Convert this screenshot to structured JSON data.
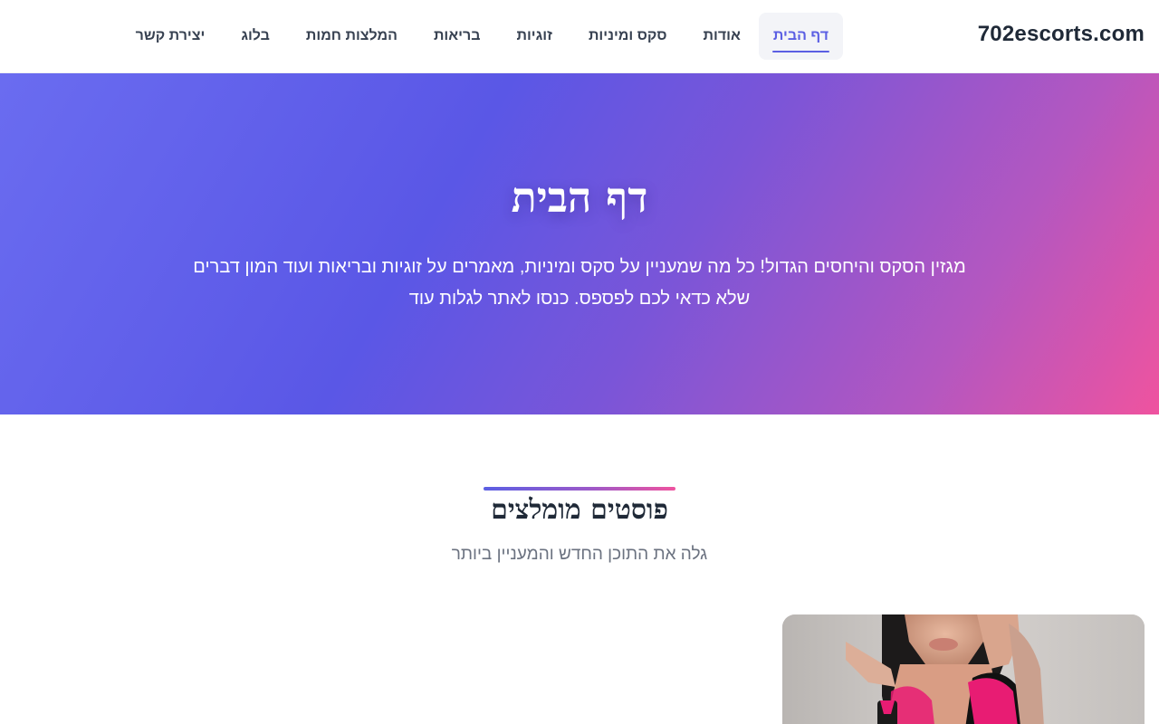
{
  "header": {
    "logo": "702escorts.com",
    "nav": [
      {
        "label": "דף הבית",
        "active": true
      },
      {
        "label": "אודות",
        "active": false
      },
      {
        "label": "סקס ומיניות",
        "active": false
      },
      {
        "label": "זוגיות",
        "active": false
      },
      {
        "label": "בריאות",
        "active": false
      },
      {
        "label": "המלצות חמות",
        "active": false
      },
      {
        "label": "בלוג",
        "active": false
      },
      {
        "label": "יצירת קשר",
        "active": false
      }
    ]
  },
  "hero": {
    "title": "דף הבית",
    "subtitle": "מגזין הסקס והיחסים הגדול! כל מה שמעניין על סקס ומיניות, מאמרים על זוגיות ובריאות ועוד המון דברים שלא כדאי לכם לפספס. כנסו לאתר לגלות עוד"
  },
  "section": {
    "title": "פוסטים מומלצים",
    "subtitle": "גלה את התוכן החדש והמעניין ביותר"
  },
  "colors": {
    "accent": "#5b5fe3",
    "pink": "#ef539f"
  }
}
